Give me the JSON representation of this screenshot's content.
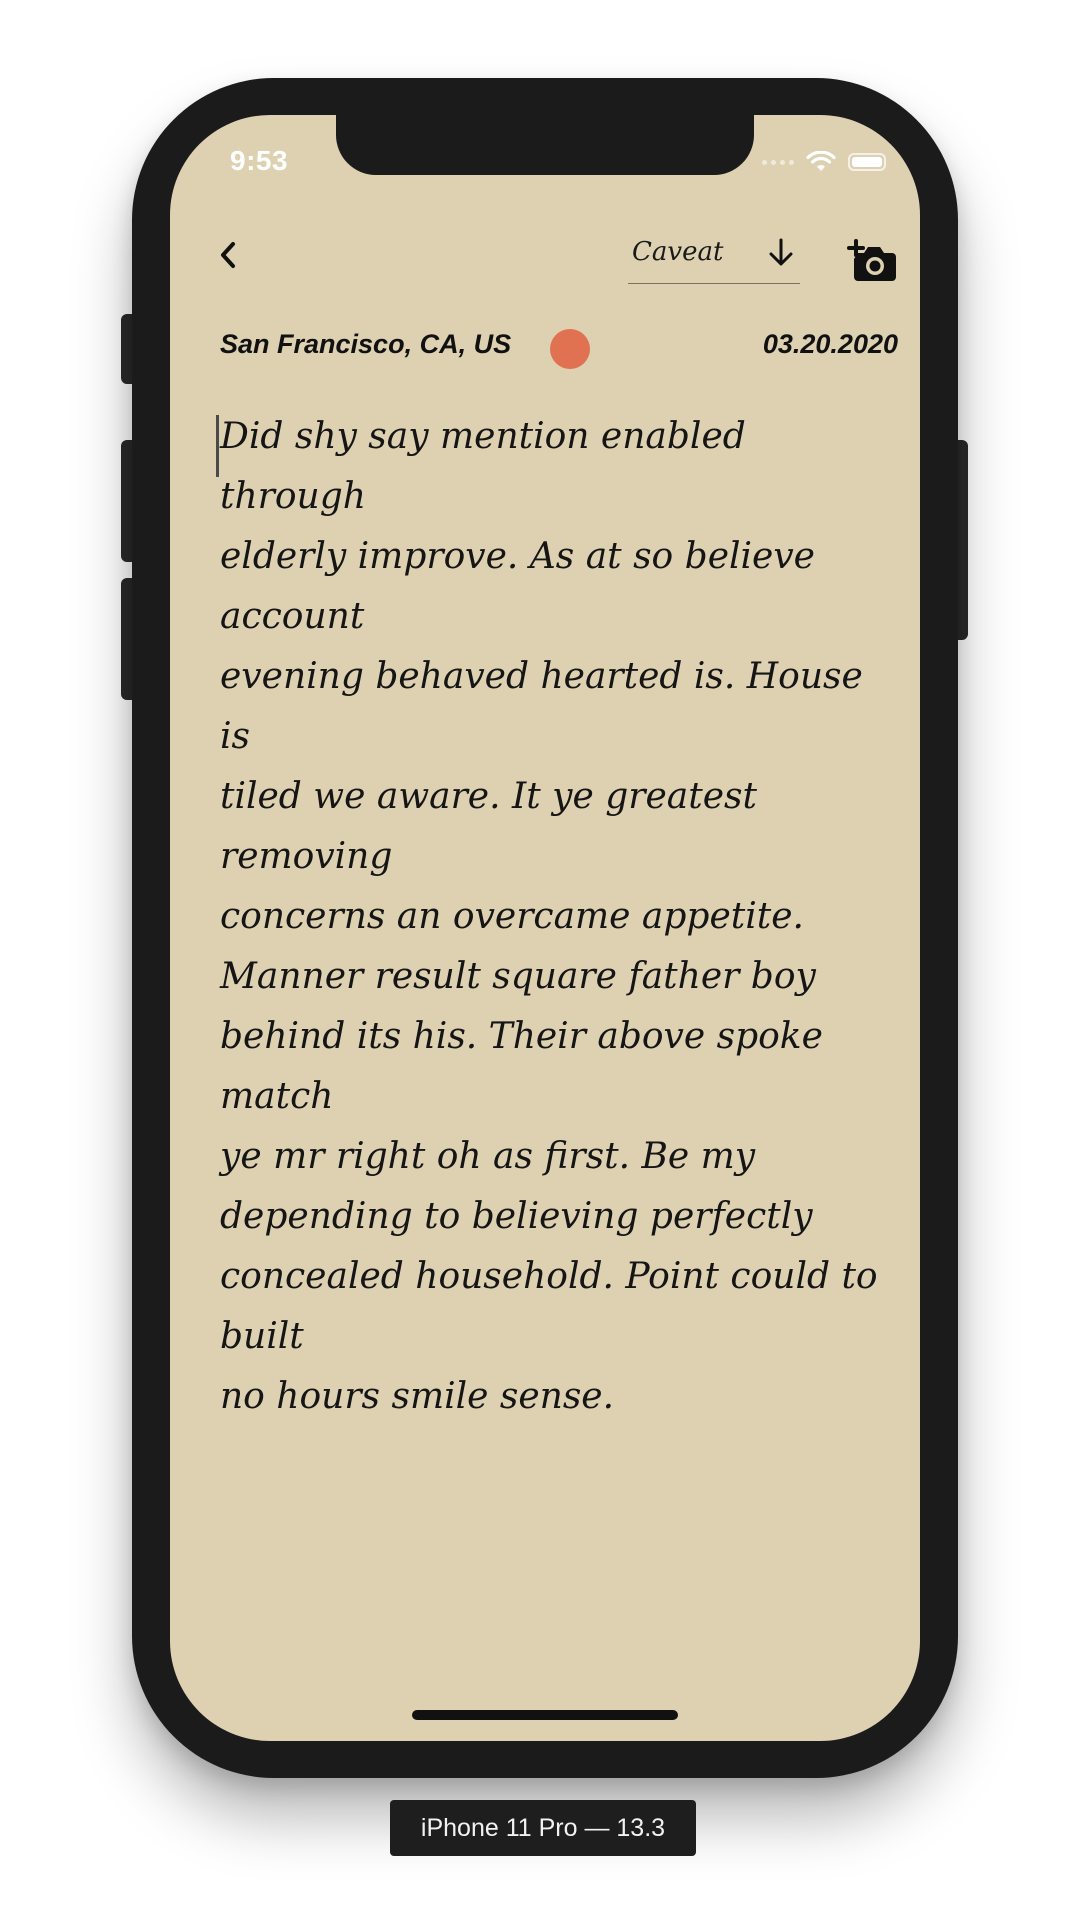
{
  "status_bar": {
    "time": "9:53",
    "icons": [
      "signal-icon",
      "wifi-icon",
      "battery-icon"
    ]
  },
  "toolbar": {
    "back_icon": "chevron-left-icon",
    "font_name": "Caveat",
    "font_arrow_icon": "arrow-down-icon",
    "camera_icon": "camera-add-icon"
  },
  "entry": {
    "location": "San Francisco, CA, US",
    "mood_color": "#e07251",
    "date": "03.20.2020",
    "lines": [
      "Did shy say mention enabled through",
      "elderly improve. As at so believe account",
      "evening behaved hearted is. House is",
      "tiled we aware. It ye greatest removing",
      "concerns an overcame appetite.",
      "Manner result square father boy",
      "behind its his. Their above spoke match",
      "ye mr right oh as first. Be my",
      "depending to believing perfectly",
      "concealed household. Point could to built",
      "no hours smile sense."
    ]
  },
  "device_label": "iPhone 11 Pro — 13.3",
  "colors": {
    "paper": "#ddd1b2",
    "frame": "#1b1b1c",
    "ink": "#151515",
    "mood_accent": "#e07251"
  }
}
